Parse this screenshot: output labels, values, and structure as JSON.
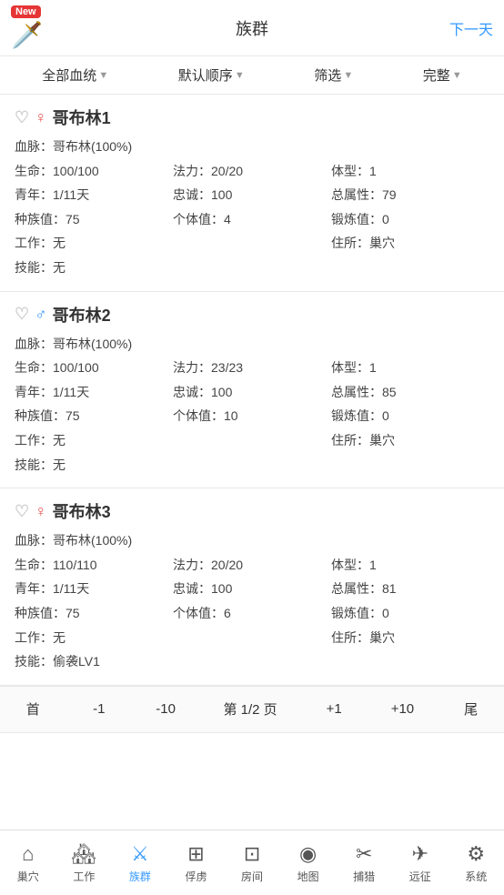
{
  "header": {
    "new_badge": "New",
    "title": "族群",
    "next_label": "下一天"
  },
  "filter_bar": {
    "items": [
      {
        "label": "全部血统",
        "arrow": "▼"
      },
      {
        "label": "默认顺序",
        "arrow": "▼"
      },
      {
        "label": "筛选",
        "arrow": "▼"
      },
      {
        "label": "完整",
        "arrow": "▼"
      }
    ]
  },
  "cards": [
    {
      "name": "哥布林1",
      "gender": "female",
      "bloodline": "哥布林(100%)",
      "hp": "100/100",
      "mp": "20/20",
      "body_type": "1",
      "youth": "1/11天",
      "loyalty": "100",
      "total_attr": "79",
      "tribe_val": "75",
      "individual_val": "4",
      "forge_val": "0",
      "work": "无",
      "residence": "巢穴",
      "skill": "无"
    },
    {
      "name": "哥布林2",
      "gender": "male",
      "bloodline": "哥布林(100%)",
      "hp": "100/100",
      "mp": "23/23",
      "body_type": "1",
      "youth": "1/11天",
      "loyalty": "100",
      "total_attr": "85",
      "tribe_val": "75",
      "individual_val": "10",
      "forge_val": "0",
      "work": "无",
      "residence": "巢穴",
      "skill": "无"
    },
    {
      "name": "哥布林3",
      "gender": "female",
      "bloodline": "哥布林(100%)",
      "hp": "110/110",
      "mp": "20/20",
      "body_type": "1",
      "youth": "1/11天",
      "loyalty": "100",
      "total_attr": "81",
      "tribe_val": "75",
      "individual_val": "6",
      "forge_val": "0",
      "work": "无",
      "residence": "巢穴",
      "skill": "偷袭LV1"
    }
  ],
  "pagination": {
    "first": "首",
    "prev1": "-1",
    "prev10": "-10",
    "page_info": "第 1/2 页",
    "next1": "+1",
    "next10": "+10",
    "last": "尾"
  },
  "bottom_nav": {
    "items": [
      {
        "icon": "⌂",
        "label": "巢穴",
        "active": false,
        "name": "nest"
      },
      {
        "icon": "🏠",
        "label": "工作",
        "active": false,
        "name": "work"
      },
      {
        "icon": "⚔",
        "label": "族群",
        "active": true,
        "name": "tribe"
      },
      {
        "icon": "⊞",
        "label": "俘虏",
        "active": false,
        "name": "captive"
      },
      {
        "icon": "⊡",
        "label": "房间",
        "active": false,
        "name": "room"
      },
      {
        "icon": "⊘",
        "label": "地图",
        "active": false,
        "name": "map"
      },
      {
        "icon": "✂",
        "label": "捕猎",
        "active": false,
        "name": "hunt"
      },
      {
        "icon": "✈",
        "label": "远征",
        "active": false,
        "name": "expedition"
      },
      {
        "icon": "⚙",
        "label": "系统",
        "active": false,
        "name": "system"
      }
    ]
  },
  "labels": {
    "bloodline": "血脉：",
    "hp": "生命：",
    "mp": "法力：",
    "body_type": "体型：",
    "youth": "青年：",
    "loyalty": "忠诚：",
    "total_attr": "总属性：",
    "tribe_val": "种族值：",
    "individual_val": "个体值：",
    "forge_val": "锻炼值：",
    "work": "工作：",
    "residence": "住所：",
    "skill": "技能："
  }
}
